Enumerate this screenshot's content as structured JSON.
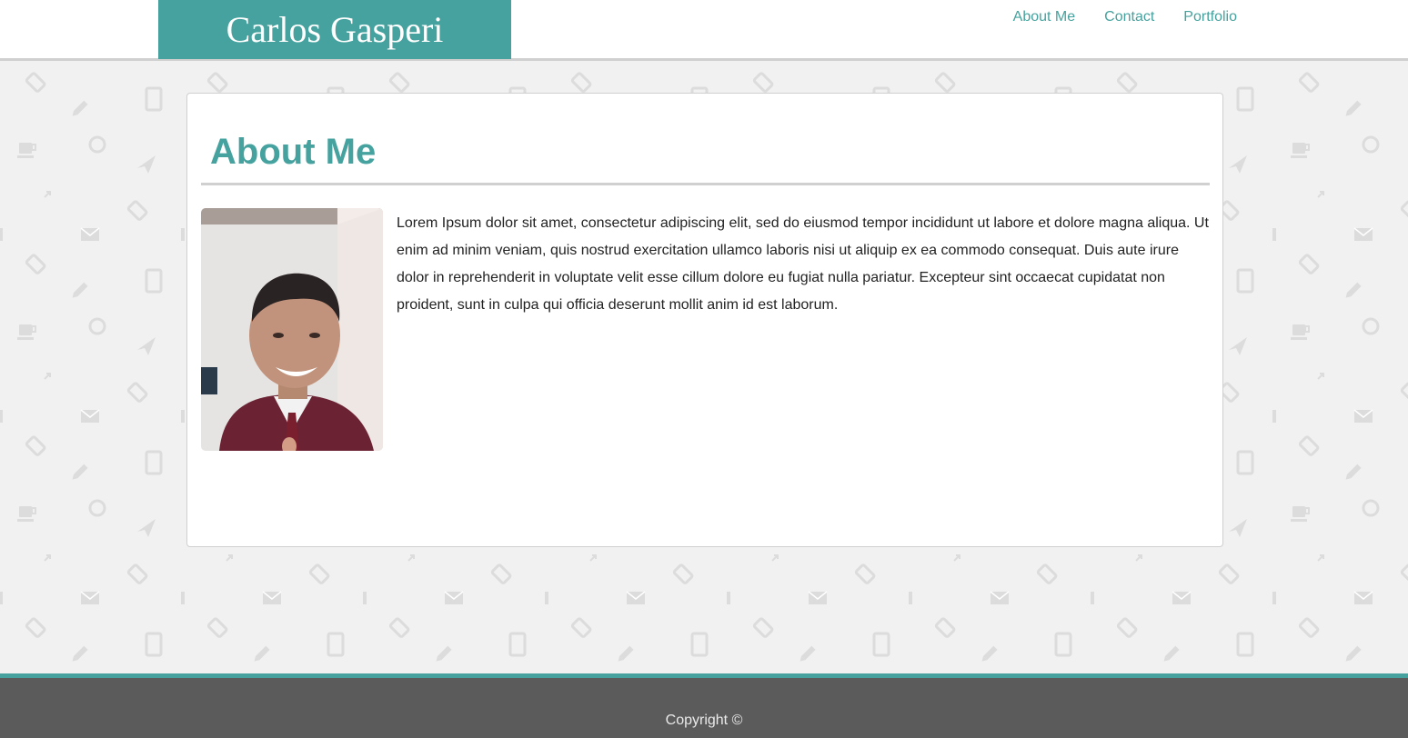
{
  "colors": {
    "accent": "#45a29e",
    "header_bg": "#ffffff",
    "page_bg": "#f1f1f1",
    "footer_bg": "#5b5b5b",
    "text": "#222222"
  },
  "header": {
    "brand": "Carlos Gasperi",
    "nav": [
      {
        "label": "About Me"
      },
      {
        "label": "Contact"
      },
      {
        "label": "Portfolio"
      }
    ]
  },
  "main": {
    "title": "About Me",
    "photo_alt": "Portrait photo of Carlos Gasperi",
    "bio": "Lorem Ipsum dolor sit amet, consectetur adipiscing elit, sed do eiusmod tempor incididunt ut labore et dolore magna aliqua. Ut enim ad minim veniam, quis nostrud exercitation ullamco laboris nisi ut aliquip ex ea commodo consequat. Duis aute irure dolor in reprehenderit in voluptate velit esse cillum dolore eu fugiat nulla pariatur. Excepteur sint occaecat cupidatat non proident, sunt in culpa qui officia deserunt mollit anim id est laborum."
  },
  "footer": {
    "copyright": "Copyright ©"
  },
  "icons": {
    "background_pattern": [
      "tag-icon",
      "pencil-icon",
      "tablet-icon",
      "coffee-cup-icon",
      "refresh-icon",
      "paper-plane-icon",
      "expand-icon",
      "envelope-icon"
    ]
  }
}
